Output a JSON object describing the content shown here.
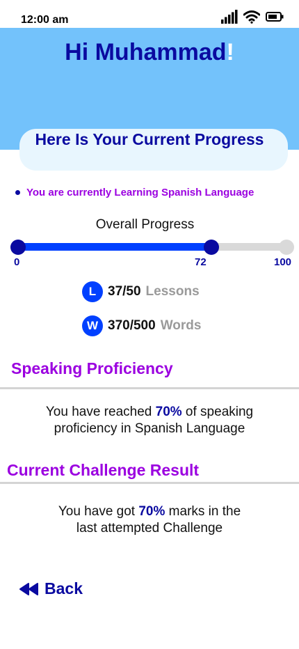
{
  "status_bar": {
    "time": "12:00 am"
  },
  "header": {
    "greeting": "Hi Muhammad",
    "greeting_suffix": "!",
    "progress_heading": "Here Is Your Current Progress"
  },
  "learning": {
    "text": "You are currently Learning Spanish Language"
  },
  "overall_progress": {
    "label": "Overall Progress",
    "min": 0,
    "value": 72,
    "max": 100,
    "min_label": "0",
    "value_label": "72",
    "max_label": "100",
    "fill_color": "#0040ff",
    "knob_color": "#0a0aa0"
  },
  "stats": [
    {
      "badge": "L",
      "value": "37/50",
      "unit": "Lessons"
    },
    {
      "badge": "W",
      "value": "370/500",
      "unit": "Words"
    }
  ],
  "speaking": {
    "title": "Speaking Proficiency",
    "text_before": "You have reached ",
    "highlight": "70%",
    "text_after": " of speaking",
    "line2": "proficiency in Spanish Language"
  },
  "challenge": {
    "title": "Current Challenge Result",
    "text_before": "You have got ",
    "highlight": "70%",
    "text_after": " marks in the",
    "line2": "last attempted Challenge"
  },
  "back": {
    "label": "Back",
    "icon": "rewind-icon"
  },
  "colors": {
    "header_bg": "#73c2fb",
    "primary_text": "#0a0aa0",
    "accent_purple": "#9b00e0",
    "accent_blue": "#0040ff"
  }
}
